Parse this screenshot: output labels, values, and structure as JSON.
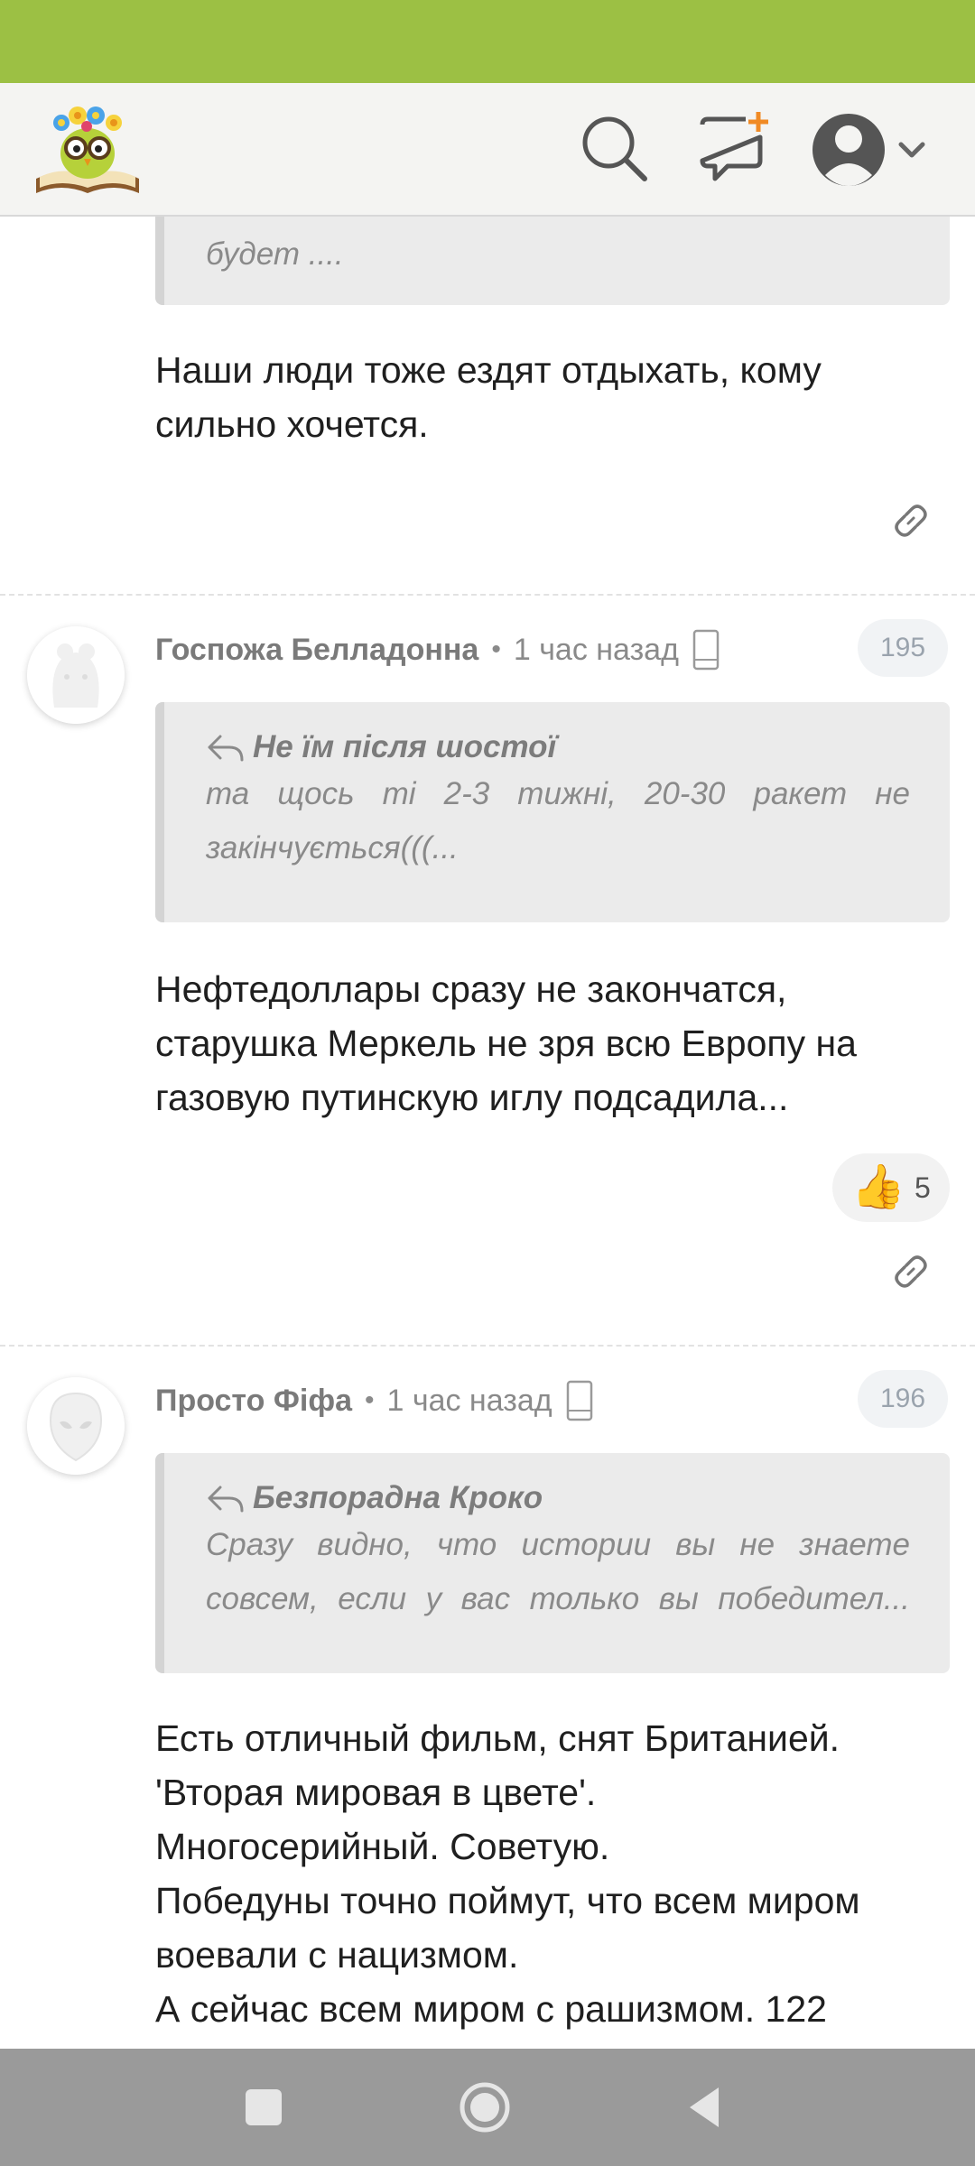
{
  "header": {
    "logo_icon": "owl-on-book-logo",
    "search_icon": "search-icon",
    "new_post_icon": "new-comment-icon",
    "account_icon": "user-avatar-icon"
  },
  "top_fragment": {
    "quote_tail": "будет ....",
    "body": "Наши люди тоже ездят отдыхать, кому\nсильно хочется."
  },
  "comments": [
    {
      "username": "Госпожа Белладонна",
      "time": "1 час назад",
      "number": "195",
      "quote_author": "Не їм після шостої",
      "quote_text_line1": "та щось ті 2-3 тижні, 20-30 ракет не",
      "quote_text_line2": "закінчується(((...",
      "body": "Нефтедоллары сразу не закончатся,\nстарушка Меркель не зря всю Европу на\nгазовую путинскую иглу подсадила...",
      "likes": "5"
    },
    {
      "username": "Просто Фіфа",
      "time": "1 час назад",
      "number": "196",
      "quote_author": "Безпорадна Кроко",
      "quote_text_line1": "Сразу видно, что истории вы не знаете",
      "quote_text_line2": "совсем, если у вас только вы победител...",
      "body": "Есть отличный фильм, снят Британией.\n'Вторая мировая в цвете'.\nМногосерийный. Советую.\nПобедуны точно поймут, что всем миром\nвоевали с нацизмом.\nА сейчас всем миром с рашизмом. 122"
    }
  ],
  "colors": {
    "status_bar": "#9cc044",
    "header_bg": "#f4f4f2",
    "quote_bg": "#ebebeb",
    "nav_bar": "#9a9a9a"
  }
}
